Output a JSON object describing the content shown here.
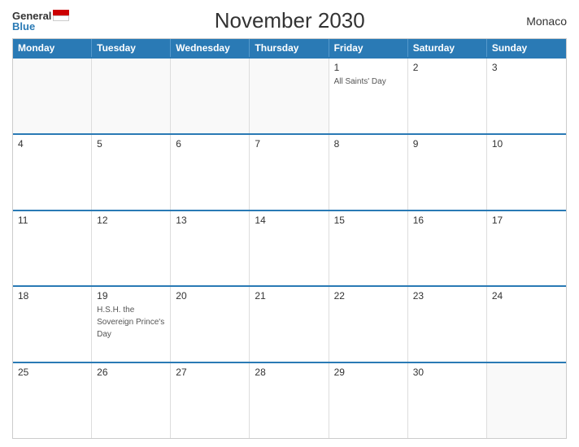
{
  "header": {
    "title": "November 2030",
    "country": "Monaco"
  },
  "logo": {
    "general": "General",
    "blue": "Blue"
  },
  "days": [
    "Monday",
    "Tuesday",
    "Wednesday",
    "Thursday",
    "Friday",
    "Saturday",
    "Sunday"
  ],
  "weeks": [
    [
      {
        "num": "",
        "holiday": ""
      },
      {
        "num": "",
        "holiday": ""
      },
      {
        "num": "",
        "holiday": ""
      },
      {
        "num": "",
        "holiday": ""
      },
      {
        "num": "1",
        "holiday": "All Saints' Day"
      },
      {
        "num": "2",
        "holiday": ""
      },
      {
        "num": "3",
        "holiday": ""
      }
    ],
    [
      {
        "num": "4",
        "holiday": ""
      },
      {
        "num": "5",
        "holiday": ""
      },
      {
        "num": "6",
        "holiday": ""
      },
      {
        "num": "7",
        "holiday": ""
      },
      {
        "num": "8",
        "holiday": ""
      },
      {
        "num": "9",
        "holiday": ""
      },
      {
        "num": "10",
        "holiday": ""
      }
    ],
    [
      {
        "num": "11",
        "holiday": ""
      },
      {
        "num": "12",
        "holiday": ""
      },
      {
        "num": "13",
        "holiday": ""
      },
      {
        "num": "14",
        "holiday": ""
      },
      {
        "num": "15",
        "holiday": ""
      },
      {
        "num": "16",
        "holiday": ""
      },
      {
        "num": "17",
        "holiday": ""
      }
    ],
    [
      {
        "num": "18",
        "holiday": ""
      },
      {
        "num": "19",
        "holiday": "H.S.H. the Sovereign Prince's Day"
      },
      {
        "num": "20",
        "holiday": ""
      },
      {
        "num": "21",
        "holiday": ""
      },
      {
        "num": "22",
        "holiday": ""
      },
      {
        "num": "23",
        "holiday": ""
      },
      {
        "num": "24",
        "holiday": ""
      }
    ],
    [
      {
        "num": "25",
        "holiday": ""
      },
      {
        "num": "26",
        "holiday": ""
      },
      {
        "num": "27",
        "holiday": ""
      },
      {
        "num": "28",
        "holiday": ""
      },
      {
        "num": "29",
        "holiday": ""
      },
      {
        "num": "30",
        "holiday": ""
      },
      {
        "num": "",
        "holiday": ""
      }
    ]
  ]
}
